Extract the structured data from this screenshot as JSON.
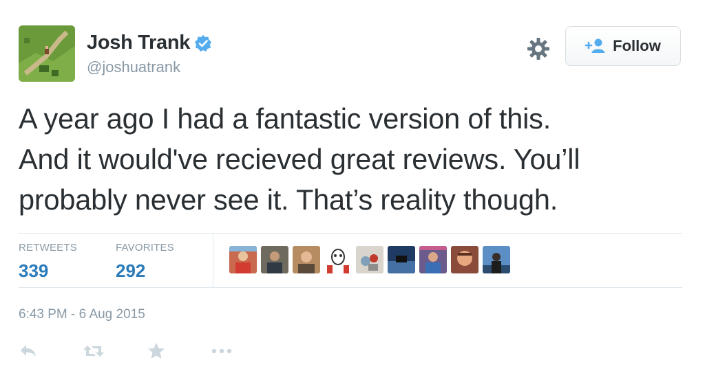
{
  "user": {
    "display_name": "Josh Trank",
    "handle": "@joshuatrank",
    "verified": true,
    "avatar_icon": "pixel-art-landscape-avatar"
  },
  "header": {
    "follow_label": "Follow",
    "settings_icon": "gear-icon",
    "follow_icon": "add-user-icon"
  },
  "tweet": {
    "lines": [
      "A year ago I had a fantastic version of this.",
      "And it would've recieved great reviews. You’ll",
      "probably never see it. That’s reality though."
    ]
  },
  "stats": {
    "retweets_label": "RETWEETS",
    "retweets_count": "339",
    "favorites_label": "FAVORITES",
    "favorites_count": "292",
    "favoriter_avatars": [
      "favoriter-avatar-1",
      "favoriter-avatar-2",
      "favoriter-avatar-3",
      "favoriter-avatar-4",
      "favoriter-avatar-5",
      "favoriter-avatar-6",
      "favoriter-avatar-7",
      "favoriter-avatar-8",
      "favoriter-avatar-9"
    ]
  },
  "timestamp": "6:43 PM - 6 Aug 2015",
  "actions": [
    "reply-icon",
    "retweet-icon",
    "favorite-icon",
    "more-icon"
  ],
  "colors": {
    "text": "#292f33",
    "muted": "#8899a6",
    "link": "#2b7bb9",
    "verified": "#55acee",
    "divider": "#e1e8ed"
  }
}
